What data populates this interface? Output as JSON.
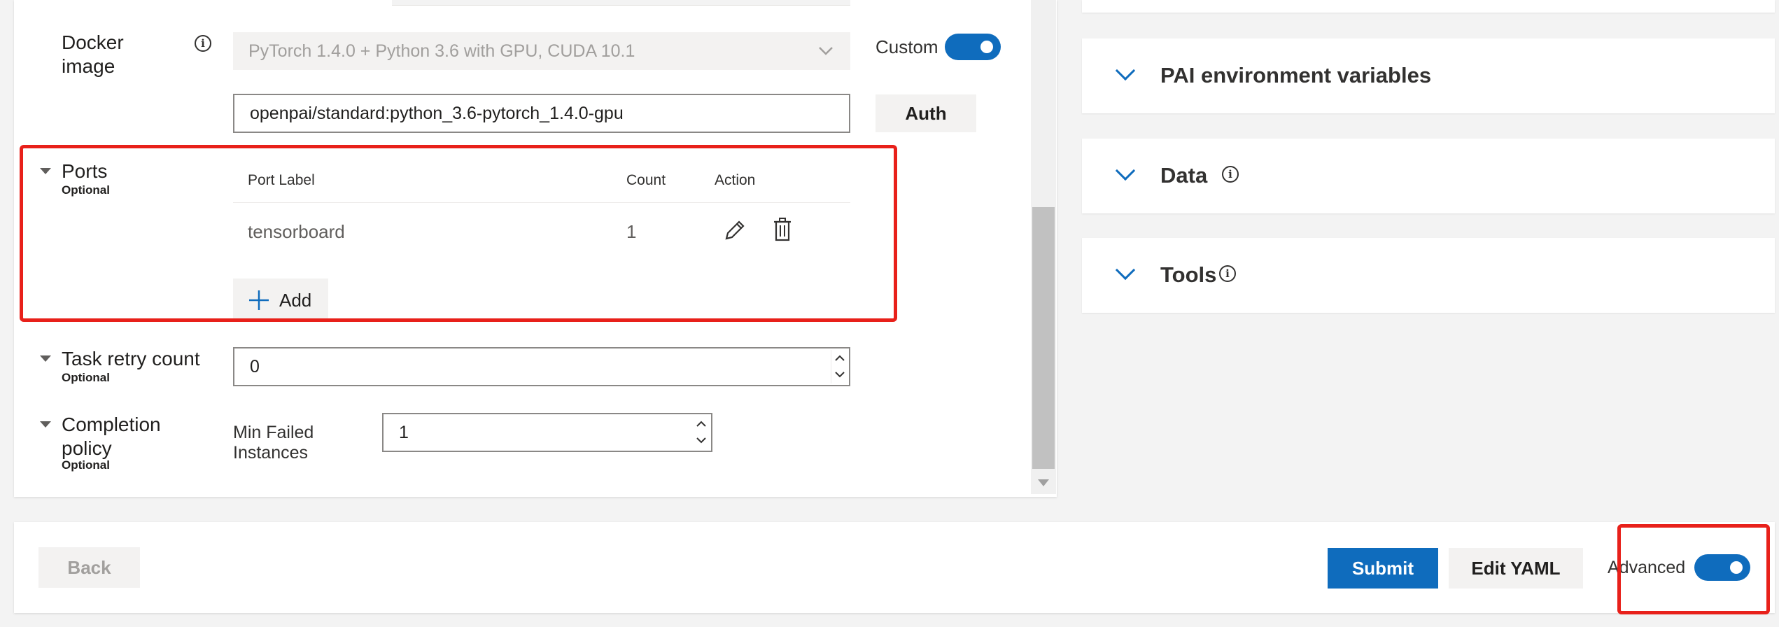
{
  "docker": {
    "label_line1": "Docker",
    "label_line2": "image",
    "info_glyph": "i",
    "dropdown_value": "PyTorch 1.4.0 + Python 3.6 with GPU, CUDA 10.1",
    "custom_label": "Custom",
    "custom_on": true,
    "image_value": "openpai/standard:python_3.6-pytorch_1.4.0-gpu",
    "auth_label": "Auth"
  },
  "ports": {
    "label": "Ports",
    "optional": "Optional",
    "columns": [
      "Port Label",
      "Count",
      "Action"
    ],
    "rows": [
      {
        "label": "tensorboard",
        "count": "1"
      }
    ],
    "add_label": "Add"
  },
  "task_retry": {
    "label": "Task retry count",
    "optional": "Optional",
    "value": "0"
  },
  "completion": {
    "label_line1": "Completion",
    "label_line2": "policy",
    "optional": "Optional",
    "field_label_line1": "Min Failed",
    "field_label_line2": "Instances",
    "value": "1"
  },
  "side_panels": [
    {
      "title": "PAI environment variables",
      "has_info": false
    },
    {
      "title": "Data",
      "has_info": true
    },
    {
      "title": "Tools",
      "has_info": true
    }
  ],
  "footer": {
    "back_label": "Back",
    "submit_label": "Submit",
    "edit_yaml_label": "Edit YAML",
    "advanced_label": "Advanced",
    "advanced_on": true
  },
  "colors": {
    "accent": "#0f6cbd",
    "highlight_box": "#e8201a"
  }
}
